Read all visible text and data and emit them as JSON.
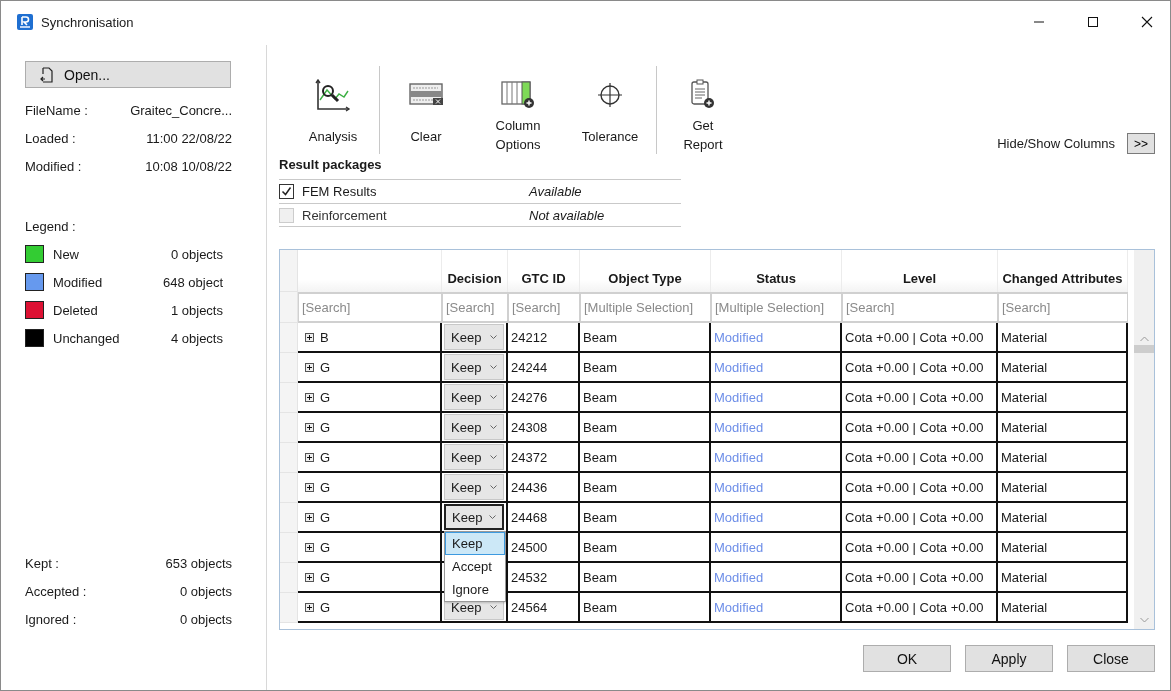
{
  "window": {
    "title": "Synchronisation"
  },
  "file_panel": {
    "open_button": "Open...",
    "info": [
      {
        "label": "FileName :",
        "value": "Graitec_Concre..."
      },
      {
        "label": "Loaded :",
        "value": "11:00 22/08/22"
      },
      {
        "label": "Modified :",
        "value": "10:08 10/08/22"
      }
    ]
  },
  "legend": {
    "title": "Legend :",
    "items": [
      {
        "label": "New",
        "count": "0 objects",
        "color": "#33cc33"
      },
      {
        "label": "Modified",
        "count": "648 object",
        "color": "#6699ee"
      },
      {
        "label": "Deleted",
        "count": "1 objects",
        "color": "#dd1133"
      },
      {
        "label": "Unchanged",
        "count": "4 objects",
        "color": "#000000"
      }
    ]
  },
  "summary": [
    {
      "label": "Kept :",
      "value": "653 objects"
    },
    {
      "label": "Accepted :",
      "value": "0 objects"
    },
    {
      "label": "Ignored :",
      "value": "0 objects"
    }
  ],
  "toolbar": [
    {
      "label": "Analysis",
      "kind": "analysis",
      "separator_after": true
    },
    {
      "label": "Clear",
      "kind": "clear",
      "separator_after": false
    },
    {
      "label": "Column Options",
      "kind": "columns",
      "separator_after": false
    },
    {
      "label": "Tolerance",
      "kind": "tolerance",
      "separator_after": true
    },
    {
      "label": "Get Report",
      "kind": "report",
      "separator_after": false
    }
  ],
  "hide_show_columns": {
    "label": "Hide/Show Columns",
    "button": ">>"
  },
  "result_packages": {
    "title": "Result packages",
    "items": [
      {
        "name": "FEM Results",
        "checked": true,
        "disabled": false,
        "availability": "Available"
      },
      {
        "name": "Reinforcement",
        "checked": false,
        "disabled": true,
        "availability": "Not available"
      }
    ]
  },
  "table": {
    "columns": [
      {
        "kind": "tree",
        "placeholder": "[Search]"
      },
      {
        "kind": "decision",
        "label": "Decision",
        "placeholder": "[Search]"
      },
      {
        "kind": "text",
        "label": "GTC ID",
        "placeholder": "[Search]"
      },
      {
        "kind": "text",
        "label": "Object Type",
        "placeholder": "[Multiple Selection]"
      },
      {
        "kind": "status",
        "label": "Status",
        "placeholder": "[Multiple Selection]"
      },
      {
        "kind": "text",
        "label": "Level",
        "placeholder": "[Search]"
      },
      {
        "kind": "text",
        "label": "Changed Attributes",
        "placeholder": "[Search]"
      }
    ],
    "rows": [
      {
        "expanded": false,
        "cells": [
          "B",
          "Keep",
          "24212",
          "Beam",
          "Modified",
          "Cota +0.00 | Cota +0.00",
          "Material"
        ]
      },
      {
        "expanded": false,
        "cells": [
          "G",
          "Keep",
          "24244",
          "Beam",
          "Modified",
          "Cota +0.00 | Cota +0.00",
          "Material"
        ]
      },
      {
        "expanded": false,
        "cells": [
          "G",
          "Keep",
          "24276",
          "Beam",
          "Modified",
          "Cota +0.00 | Cota +0.00",
          "Material"
        ]
      },
      {
        "expanded": false,
        "cells": [
          "G",
          "Keep",
          "24308",
          "Beam",
          "Modified",
          "Cota +0.00 | Cota +0.00",
          "Material"
        ]
      },
      {
        "expanded": false,
        "cells": [
          "G",
          "Keep",
          "24372",
          "Beam",
          "Modified",
          "Cota +0.00 | Cota +0.00",
          "Material"
        ]
      },
      {
        "expanded": false,
        "cells": [
          "G",
          "Keep",
          "24436",
          "Beam",
          "Modified",
          "Cota +0.00 | Cota +0.00",
          "Material"
        ]
      },
      {
        "expanded": false,
        "cells": [
          "G",
          "Keep",
          "24468",
          "Beam",
          "Modified",
          "Cota +0.00 | Cota +0.00",
          "Material"
        ],
        "dropdown": [
          {
            "label": "Keep",
            "selected": true
          },
          {
            "label": "Accept",
            "selected": false
          },
          {
            "label": "Ignore",
            "selected": false
          }
        ]
      },
      {
        "expanded": false,
        "cells": [
          "G",
          "",
          "24500",
          "Beam",
          "Modified",
          "Cota +0.00 | Cota +0.00",
          "Material"
        ]
      },
      {
        "expanded": false,
        "cells": [
          "G",
          "",
          "24532",
          "Beam",
          "Modified",
          "Cota +0.00 | Cota +0.00",
          "Material"
        ]
      },
      {
        "expanded": false,
        "cells": [
          "G",
          "Keep",
          "24564",
          "Beam",
          "Modified",
          "Cota +0.00 | Cota +0.00",
          "Material"
        ]
      }
    ]
  },
  "buttons": [
    "OK",
    "Apply",
    "Close"
  ]
}
